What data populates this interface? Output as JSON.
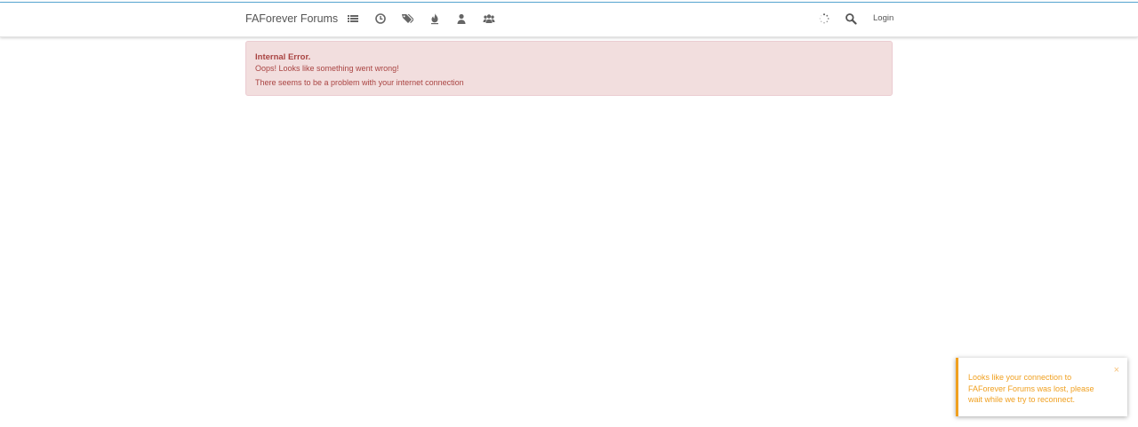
{
  "navbar": {
    "brand": "FAForever Forums",
    "icons": [
      "categories-icon",
      "recent-icon",
      "tags-icon",
      "popular-icon",
      "users-icon",
      "groups-icon"
    ],
    "loading_icon": "loading-spinner-icon",
    "search_icon": "search-icon",
    "login_label": "Login"
  },
  "alert": {
    "title": "Internal Error.",
    "message": "Oops! Looks like something went wrong!",
    "detail": "There seems to be a problem with your internet connection"
  },
  "toast": {
    "message": "Looks like your connection to FAForever Forums was lost, please wait while we try to reconnect.",
    "close": "×"
  },
  "colors": {
    "alert_background": "#f2dede",
    "alert_text": "#a94442",
    "toast_accent": "#f0a020",
    "top_line": "#5aa9d6"
  }
}
